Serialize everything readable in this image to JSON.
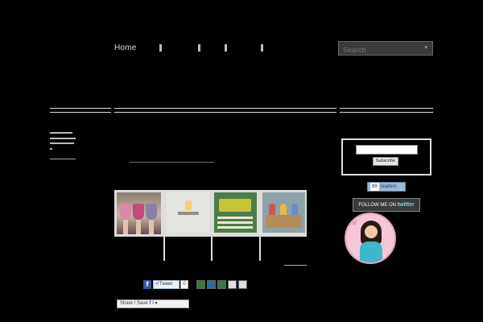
{
  "header": {
    "nav_home": "Home",
    "search_placeholder": "Search",
    "search_arrow_icon": "chevron-down-icon"
  },
  "post": {
    "sidebar_label": "",
    "photos": [
      "photo-fashion-skirts",
      "photo-desk-lamp",
      "photo-green-poster",
      "photo-classroom"
    ],
    "share": {
      "facebook_icon": "f",
      "tweet_label": "Tweet",
      "tweet_count": "0",
      "share_save_label": "Share / Save"
    }
  },
  "sidebar": {
    "subscribe_label": "Subscribe",
    "feed_count": "89",
    "feed_label": "readers",
    "follow_label": "FOLLOW ME ON",
    "twitter_word": "twitter"
  },
  "colors": {
    "background": "#000000",
    "facebook": "#3b5998",
    "twitter": "#2b9ad9",
    "avatar_bg": "#f4c6d8"
  }
}
